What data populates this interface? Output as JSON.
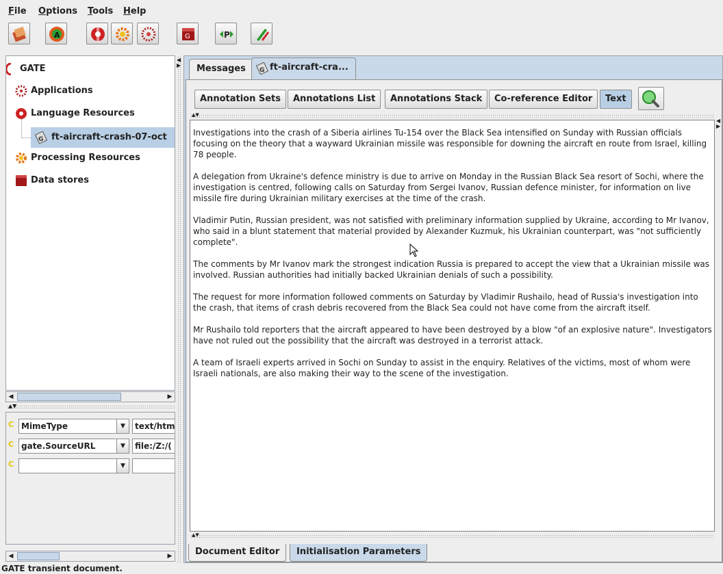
{
  "menu": {
    "items": [
      {
        "mnemonic": "F",
        "rest": "ile"
      },
      {
        "mnemonic": "O",
        "rest": "ptions"
      },
      {
        "mnemonic": "T",
        "rest": "ools"
      },
      {
        "mnemonic": "H",
        "rest": "elp"
      }
    ]
  },
  "tree": {
    "root": "GATE",
    "applications": "Applications",
    "language_resources": "Language Resources",
    "document": "ft-aircraft-crash-07-oct",
    "processing_resources": "Processing Resources",
    "data_stores": "Data stores"
  },
  "features": {
    "rows": [
      {
        "name": "MimeType",
        "value": "text/htm"
      },
      {
        "name": "gate.SourceURL",
        "value": "file:/Z:/("
      },
      {
        "name": "",
        "value": ""
      }
    ],
    "type_mark": "C"
  },
  "tabs": {
    "messages": "Messages",
    "document": "ft-aircraft-cra..."
  },
  "view_buttons": {
    "annotation_sets": "Annotation Sets",
    "annotations_list": "Annotations List",
    "annotations_stack": "Annotations Stack",
    "coreference": "Co-reference Editor",
    "text": "Text"
  },
  "document_text": [
    "Investigations into the crash of a Siberia airlines Tu-154 over the Black Sea intensified on Sunday with Russian officials focusing on the theory that a wayward Ukrainian missile was responsible for downing the aircraft en route from Israel, killing 78 people.",
    "A delegation from Ukraine's defence ministry is due to arrive on Monday in the Russian Black Sea resort of Sochi, where the investigation is centred, following calls on Saturday from Sergei Ivanov, Russian defence minister, for information on live missile fire during Ukrainian military exercises at the time of the crash.",
    "Vladimir Putin, Russian president, was not satisfied with preliminary information supplied by Ukraine, according to Mr Ivanov, who said in a blunt statement that material provided by Alexander Kuzmuk, his Ukrainian counterpart, was \"not sufficiently complete\".",
    "The comments by Mr Ivanov mark the strongest indication Russia is prepared to accept the view that a Ukrainian missile was involved. Russian authorities had initially backed Ukrainian denials of such a possibility.",
    "The request for more information followed comments on Saturday by Vladimir Rushailo, head of Russia's investigation into the crash, that items of crash debris recovered from the Black Sea could not have come from the aircraft itself.",
    "Mr Rushailo told reporters that the aircraft appeared to have been destroyed by a blow \"of an explosive nature\". Investigators have not ruled out the possibility that the aircraft was destroyed in a terrorist attack.",
    "A team of Israeli experts arrived in Sochi on Sunday to assist in the enquiry. Relatives of the victims, most of whom were Israeli nationals, are also making their way to the scene of the investigation."
  ],
  "bottom_tabs": {
    "document_editor": "Document Editor",
    "init_params": "Initialisation Parameters"
  },
  "status": "GATE transient document.",
  "icons": {
    "open": "load-application-icon",
    "annie": "annie-icon",
    "new_lr": "new-language-resource-icon",
    "new_pr": "new-processing-resource-icon",
    "new_app": "new-application-icon",
    "datastore": "datastore-icon",
    "pipeline": "pipeline-icon",
    "annotation_diff": "annotation-diff-icon",
    "search": "search-icon"
  },
  "colors": {
    "selection": "#b8cfe5",
    "panel_bg": "#c9d9ea"
  }
}
